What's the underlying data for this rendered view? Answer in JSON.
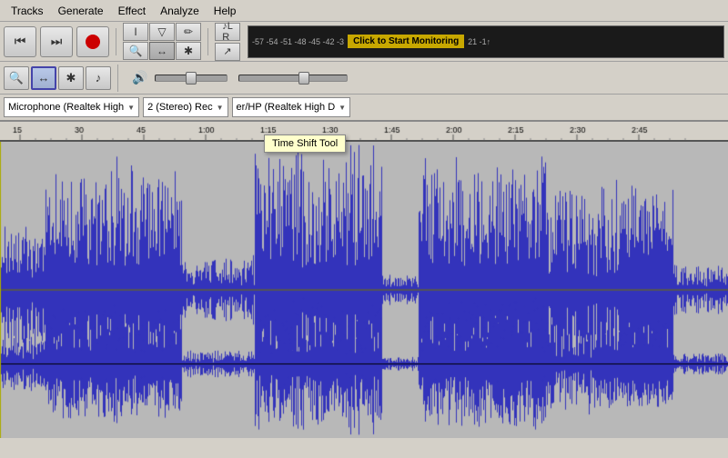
{
  "menu": {
    "items": [
      "Tracks",
      "Generate",
      "Effect",
      "Analyze",
      "Help"
    ]
  },
  "toolbar": {
    "transport": {
      "rewind_label": "⏮",
      "fastforward_label": "⏭",
      "record_label": "●"
    },
    "tools_row1": [
      {
        "id": "select",
        "label": "I",
        "active": false
      },
      {
        "id": "envelope",
        "label": "▲",
        "active": false
      },
      {
        "id": "draw",
        "label": "✏",
        "active": false
      },
      {
        "id": "zoom",
        "label": "🔍",
        "active": false
      },
      {
        "id": "timeshift",
        "label": "↔",
        "active": true
      },
      {
        "id": "multi",
        "label": "✱",
        "active": false
      }
    ],
    "tools_row2": [
      {
        "id": "pitch",
        "label": "♪",
        "active": false
      },
      {
        "id": "sample",
        "label": "↗",
        "active": false
      }
    ]
  },
  "vu_meter": {
    "scale": "-57 -54 -51 -48 -45 -42 -3",
    "monitor_label": "Click to Start Monitoring",
    "right_scale": "21 -1↑"
  },
  "devices": {
    "input_label": "Microphone (Realtek High",
    "mode_label": "2 (Stereo) Rec",
    "output_label": "er/HP (Realtek High D"
  },
  "tooltip": {
    "text": "Time Shift Tool"
  },
  "timeline": {
    "markers": [
      {
        "time": "15",
        "pos": 22
      },
      {
        "time": "30",
        "pos": 90
      },
      {
        "time": "45",
        "pos": 158
      },
      {
        "time": "1:00",
        "pos": 226
      },
      {
        "time": "1:15",
        "pos": 294
      },
      {
        "time": "1:30",
        "pos": 362
      },
      {
        "time": "1:45",
        "pos": 430
      },
      {
        "time": "2:00",
        "pos": 498
      },
      {
        "time": "2:15",
        "pos": 566
      },
      {
        "time": "2:30",
        "pos": 634
      },
      {
        "time": "2:45",
        "pos": 702
      }
    ]
  },
  "waveform": {
    "color": "#3030cc",
    "background": "#c8c8c8",
    "center_line_color": "#000000"
  }
}
